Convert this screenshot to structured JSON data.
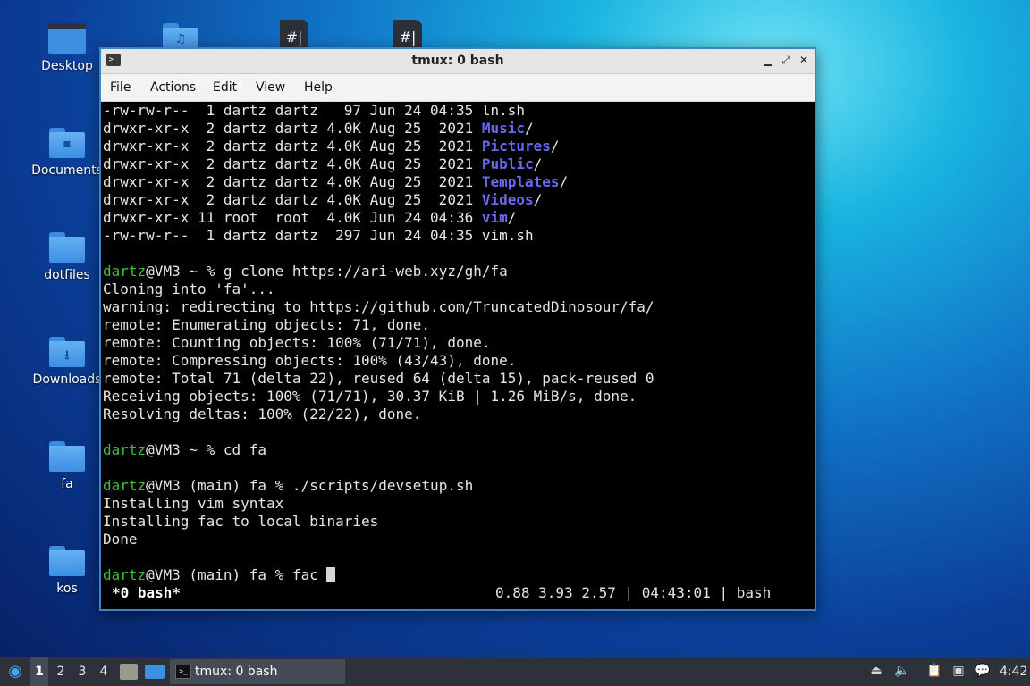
{
  "desktop": {
    "icons": [
      {
        "label": "Desktop"
      },
      {
        "label": "Documents"
      },
      {
        "label": "dotfiles"
      },
      {
        "label": "Downloads"
      },
      {
        "label": "fa"
      },
      {
        "label": "kos"
      }
    ],
    "top_row_glyph": "#|"
  },
  "window": {
    "title": "tmux: 0 bash",
    "menu": [
      "File",
      "Actions",
      "Edit",
      "View",
      "Help"
    ],
    "terminal": {
      "ls_rows": [
        {
          "prefix": "-rw-rw-r--  1 dartz dartz   97 Jun 24 04:35 ",
          "name": "ln.sh",
          "is_dir": false
        },
        {
          "prefix": "drwxr-xr-x  2 dartz dartz 4.0K Aug 25  2021 ",
          "name": "Music",
          "is_dir": true
        },
        {
          "prefix": "drwxr-xr-x  2 dartz dartz 4.0K Aug 25  2021 ",
          "name": "Pictures",
          "is_dir": true
        },
        {
          "prefix": "drwxr-xr-x  2 dartz dartz 4.0K Aug 25  2021 ",
          "name": "Public",
          "is_dir": true
        },
        {
          "prefix": "drwxr-xr-x  2 dartz dartz 4.0K Aug 25  2021 ",
          "name": "Templates",
          "is_dir": true
        },
        {
          "prefix": "drwxr-xr-x  2 dartz dartz 4.0K Aug 25  2021 ",
          "name": "Videos",
          "is_dir": true
        },
        {
          "prefix": "drwxr-xr-x 11 root  root  4.0K Jun 24 04:36 ",
          "name": "vim",
          "is_dir": true
        },
        {
          "prefix": "-rw-rw-r--  1 dartz dartz  297 Jun 24 04:35 ",
          "name": "vim.sh",
          "is_dir": false
        }
      ],
      "prompt_user": "dartz",
      "cmd1": "@VM3 ~ % g clone https://ari-web.xyz/gh/fa",
      "clone_output": [
        "Cloning into 'fa'...",
        "warning: redirecting to https://github.com/TruncatedDinosour/fa/",
        "remote: Enumerating objects: 71, done.",
        "remote: Counting objects: 100% (71/71), done.",
        "remote: Compressing objects: 100% (43/43), done.",
        "remote: Total 71 (delta 22), reused 64 (delta 15), pack-reused 0",
        "Receiving objects: 100% (71/71), 30.37 KiB | 1.26 MiB/s, done.",
        "Resolving deltas: 100% (22/22), done."
      ],
      "cmd2": "@VM3 ~ % cd fa",
      "cmd3": "@VM3 (main) fa % ./scripts/devsetup.sh",
      "setup_output": [
        "Installing vim syntax",
        "Installing fac to local binaries",
        "Done"
      ],
      "cmd4": "@VM3 (main) fa % fac "
    },
    "tmux_status": {
      "left": "*0 bash*",
      "right": "0.88 3.93 2.57 | 04:43:01 | bash"
    }
  },
  "taskbar": {
    "workspaces": [
      "1",
      "2",
      "3",
      "4"
    ],
    "active_workspace": "1",
    "task_title": "tmux: 0 bash",
    "clock": "4:42"
  }
}
